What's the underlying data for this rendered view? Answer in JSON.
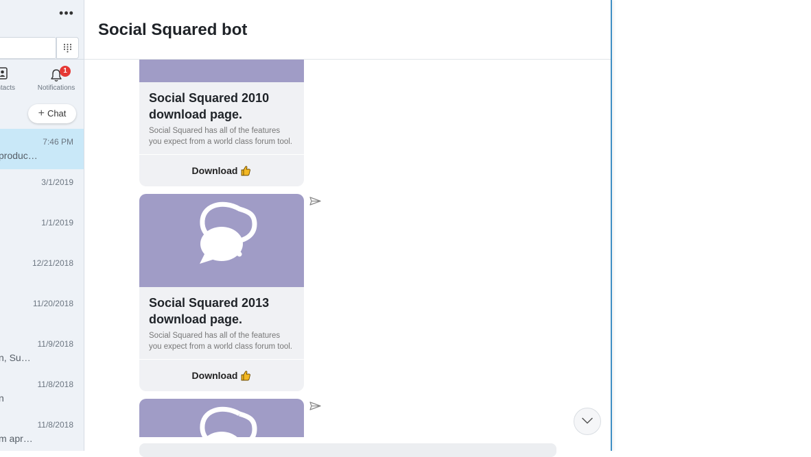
{
  "sidebar": {
    "nav": {
      "contacts_label": "Contacts",
      "notifications_label": "Notifications",
      "notifications_count": "1"
    },
    "new_chat_label": "Chat",
    "conversations": [
      {
        "time": "7:46 PM",
        "preview": "produc…",
        "active": true
      },
      {
        "time": "3/1/2019",
        "preview": ""
      },
      {
        "time": "1/1/2019",
        "preview": ""
      },
      {
        "time": "12/21/2018",
        "preview": ""
      },
      {
        "time": "11/20/2018",
        "preview": ""
      },
      {
        "time": "11/9/2018",
        "preview": "n, Su…"
      },
      {
        "time": "11/8/2018",
        "preview": "n"
      },
      {
        "time": "11/8/2018",
        "preview": "m apr…"
      }
    ]
  },
  "chat": {
    "title": "Social Squared bot",
    "cards": [
      {
        "title": "Social Squared 2010 download page.",
        "text": "Social Squared has all of the features you expect from a world class forum tool.",
        "button": "Download"
      },
      {
        "title": "Social Squared 2013 download page.",
        "text": "Social Squared has all of the features you expect from a world class forum tool.",
        "button": "Download"
      }
    ]
  },
  "colors": {
    "accent": "#3f8ec4",
    "card_hero": "#a09cc6",
    "active_conversation": "#c9e8f8",
    "badge": "#e53935"
  }
}
